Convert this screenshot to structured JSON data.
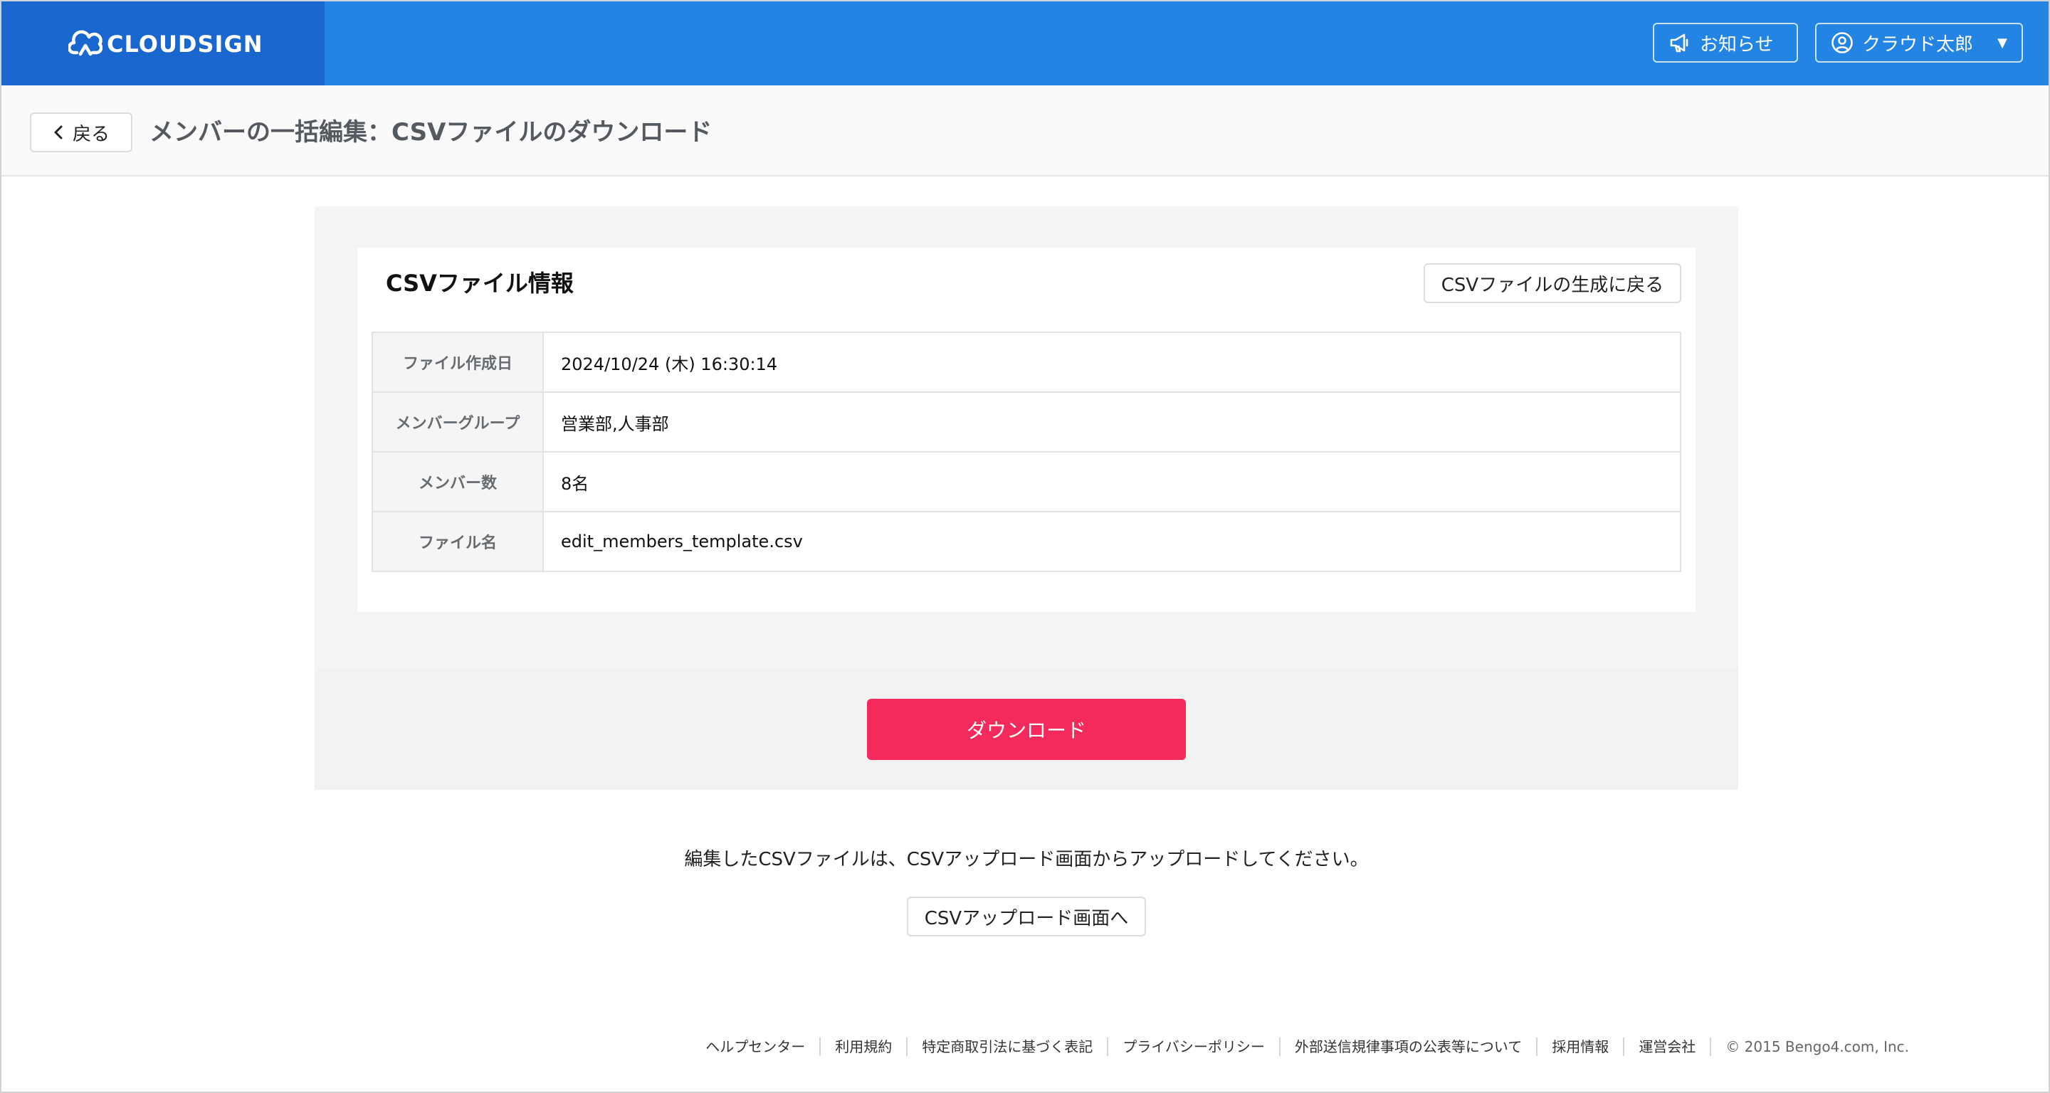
{
  "header": {
    "logo_text": "CLOUDSIGN",
    "notice_label": "お知らせ",
    "user_label": "クラウド太郎",
    "brand_color": "#2484e3",
    "logo_bg_color": "#1a66cf"
  },
  "subheader": {
    "back_label": "戻る",
    "page_title": "メンバーの一括編集：CSVファイルのダウンロード"
  },
  "card": {
    "title": "CSVファイル情報",
    "regen_label": "CSVファイルの生成に戻る",
    "rows": [
      {
        "key": "ファイル作成日",
        "value": "2024/10/24 (木) 16:30:14"
      },
      {
        "key": "メンバーグループ",
        "value": "営業部,人事部"
      },
      {
        "key": "メンバー数",
        "value": "8名"
      },
      {
        "key": "ファイル名",
        "value": "edit_members_template.csv"
      }
    ]
  },
  "download": {
    "label": "ダウンロード",
    "color": "#f42a5c"
  },
  "upload": {
    "note": "編集したCSVファイルは、CSVアップロード画面からアップロードしてください。",
    "button_label": "CSVアップロード画面へ"
  },
  "footer": {
    "links": [
      "ヘルプセンター",
      "利用規約",
      "特定商取引法に基づく表記",
      "プライバシーポリシー",
      "外部送信規律事項の公表等について",
      "採用情報",
      "運営会社"
    ],
    "copyright": "© 2015 Bengo4.com, Inc."
  },
  "icons": {
    "logo": "cloud-logo-icon",
    "notice": "megaphone-icon",
    "user": "user-circle-icon",
    "caret": "caret-down-icon",
    "back": "chevron-left-icon"
  }
}
